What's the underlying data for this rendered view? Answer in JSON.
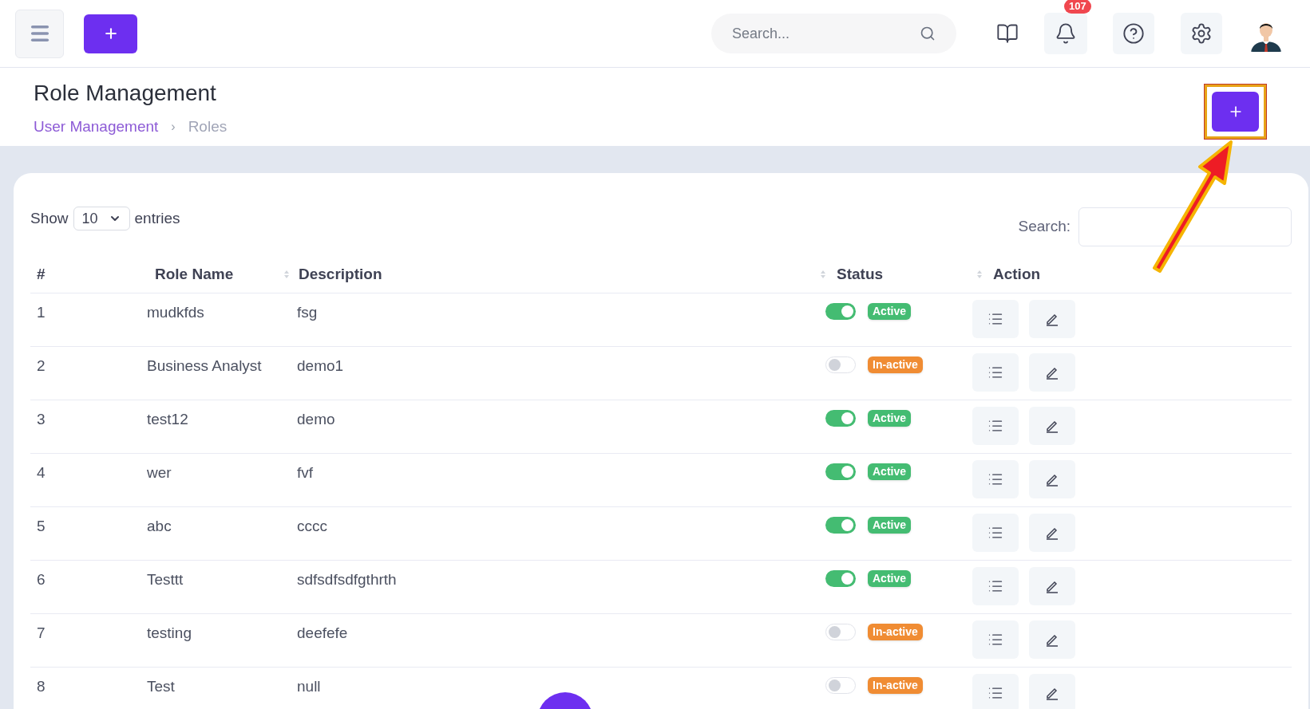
{
  "topbar": {
    "search": {
      "placeholder": "Search..."
    },
    "notifications": {
      "count": "107"
    }
  },
  "page": {
    "title": "Role Management",
    "breadcrumb": [
      {
        "label": "User Management",
        "link": true
      },
      {
        "label": "›",
        "link": false
      },
      {
        "label": "Roles",
        "link": false
      }
    ]
  },
  "table_controls": {
    "show_label": "Show",
    "page_size": "10",
    "entries_label": "entries",
    "search_label": "Search:"
  },
  "table": {
    "columns": [
      {
        "label": "#",
        "sortable": false
      },
      {
        "label": "Role Name",
        "sortable": true
      },
      {
        "label": "Description",
        "sortable": true
      },
      {
        "label": "Status",
        "sortable": true
      },
      {
        "label": "Action",
        "sortable": false
      }
    ],
    "rows": [
      {
        "index": "1",
        "role_name": "mudkfds",
        "description": "fsg",
        "on": true,
        "status": "Active"
      },
      {
        "index": "2",
        "role_name": "Business Analyst",
        "description": "demo1",
        "on": false,
        "status": "In-active"
      },
      {
        "index": "3",
        "role_name": "test12",
        "description": "demo",
        "on": true,
        "status": "Active"
      },
      {
        "index": "4",
        "role_name": "wer",
        "description": "fvf",
        "on": true,
        "status": "Active"
      },
      {
        "index": "5",
        "role_name": "abc",
        "description": "cccc",
        "on": true,
        "status": "Active"
      },
      {
        "index": "6",
        "role_name": "Testtt",
        "description": "sdfsdfsdfgthrth",
        "on": true,
        "status": "Active"
      },
      {
        "index": "7",
        "role_name": "testing",
        "description": "deefefe",
        "on": false,
        "status": "In-active"
      },
      {
        "index": "8",
        "role_name": "Test",
        "description": "null",
        "on": false,
        "status": "In-active"
      }
    ]
  }
}
